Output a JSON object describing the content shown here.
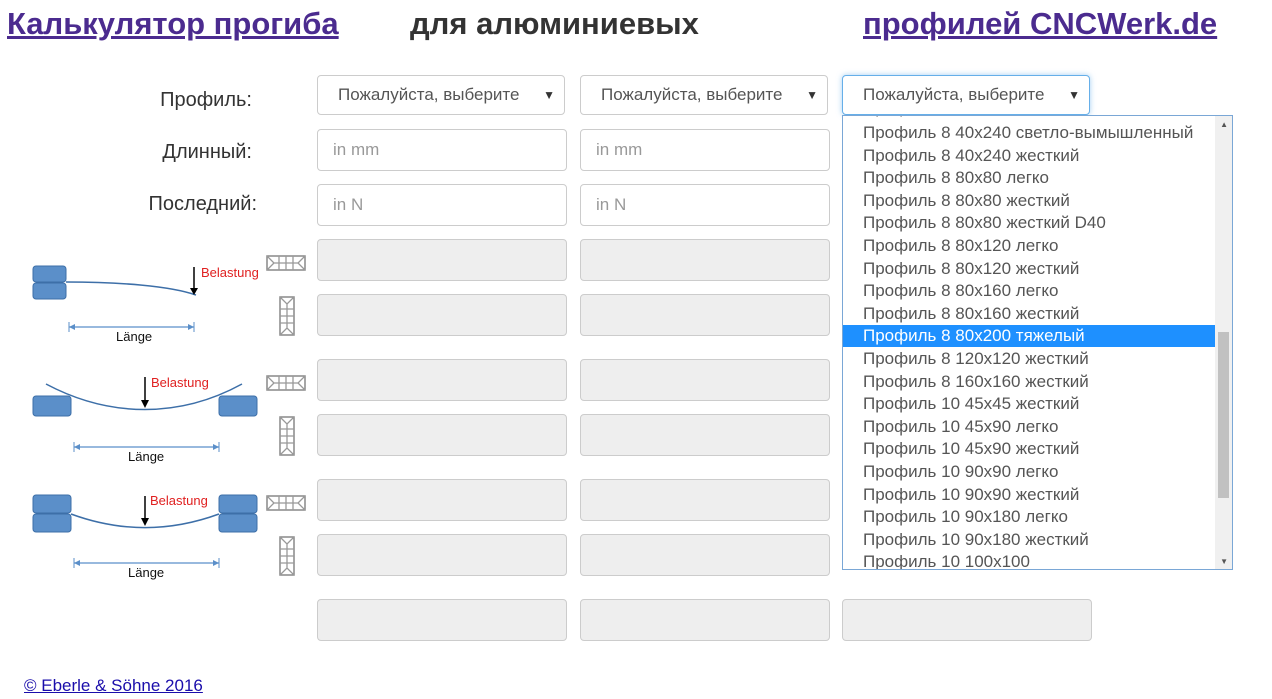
{
  "header": {
    "title_left": "Калькулятор прогиба",
    "title_mid": "для алюминиевых",
    "title_right": "профилей CNCWerk.de"
  },
  "labels": {
    "profile": "Профиль:",
    "length": "Длинный:",
    "load": "Последний:"
  },
  "selects": {
    "placeholder": "Пожалуйста, выберите"
  },
  "inputs": {
    "length_placeholder": "in mm",
    "load_placeholder": "in N"
  },
  "diagrams": {
    "load_label": "Belastung",
    "length_label": "Länge"
  },
  "dropdown": {
    "options": [
      "Профиль 8 40x240 светло-вымышленный",
      "Профиль 8 40x240 жесткий",
      "Профиль 8 80x80 легко",
      "Профиль 8 80x80 жесткий",
      "Профиль 8 80x80 жесткий D40",
      "Профиль 8 80x120 легко",
      "Профиль 8 80x120 жесткий",
      "Профиль 8 80x160 легко",
      "Профиль 8 80x160 жесткий",
      "Профиль 8 80x200 тяжелый",
      "Профиль 8 120x120 жесткий",
      "Профиль 8 160x160 жесткий",
      "Профиль 10 45x45 жесткий",
      "Профиль 10 45x90 легко",
      "Профиль 10 45x90 жесткий",
      "Профиль 10 90x90 легко",
      "Профиль 10 90x90 жесткий",
      "Профиль 10 90x180 легко",
      "Профиль 10 90x180 жесткий",
      "Профиль 10 100x100"
    ],
    "selected": "Профиль 8 80x200 тяжелый"
  },
  "footer": {
    "copyright": "© Eberle & Söhne 2016"
  },
  "colors": {
    "header_link": "#4b2b8f",
    "highlight": "#1e90ff",
    "load_label": "#e02020",
    "diagram_blue": "#5b8fc9"
  }
}
